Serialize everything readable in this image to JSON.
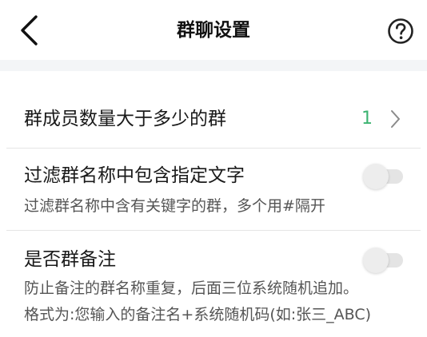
{
  "header": {
    "title": "群聊设置",
    "back_icon": "chevron-left-icon",
    "help_icon": "question-circle-icon"
  },
  "settings": {
    "member_count": {
      "label": "群成员数量大于多少的群",
      "value": "1"
    },
    "filter_keyword": {
      "label": "过滤群名称中包含指定文字",
      "description": "过滤群名称中含有关键字的群，多个用#隔开",
      "enabled": false
    },
    "group_remark": {
      "label": "是否群备注",
      "description_line1": "防止备注的群名称重复，后面三位系统随机追加。",
      "description_line2": "格式为:您输入的备注名+系统随机码(如:张三_ABC)",
      "enabled": false
    }
  },
  "colors": {
    "accent_value": "#3cb371",
    "section_gap": "#f3f5f7",
    "toggle_off": "#e4e4e4"
  }
}
